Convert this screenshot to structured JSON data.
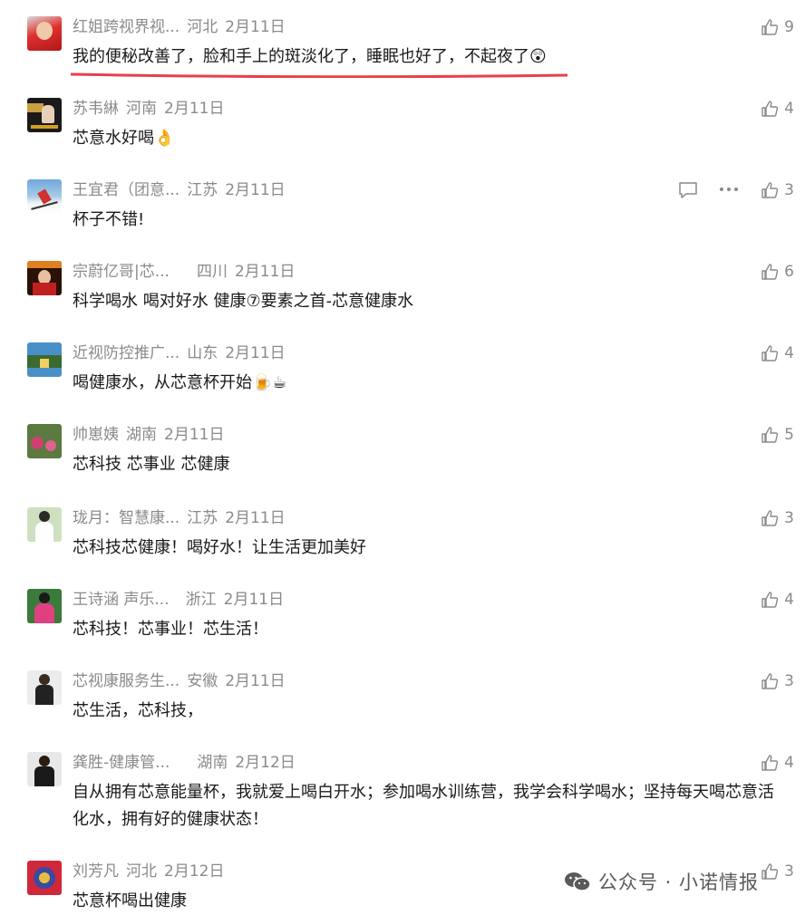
{
  "comments": [
    {
      "name": "红姐跨视界视...",
      "region": "河北",
      "date": "2月11日",
      "likes": "9",
      "text": "我的便秘改善了，脸和手上的斑淡化了，睡眠也好了，不起夜了😲"
    },
    {
      "name": "苏韦綝",
      "region": "河南",
      "date": "2月11日",
      "likes": "4",
      "text": "芯意水好喝👌"
    },
    {
      "name": "王宜君（团意...",
      "region": "江苏",
      "date": "2月11日",
      "likes": "3",
      "text": "杯子不错!"
    },
    {
      "name": "宗蔚亿哥|芯...",
      "region": "四川",
      "date": "2月11日",
      "likes": "6",
      "text": "科学喝水 喝对好水 健康⑦要素之首-芯意健康水"
    },
    {
      "name": "近视防控推广...",
      "region": "山东",
      "date": "2月11日",
      "likes": "4",
      "text": "喝健康水，从芯意杯开始🍺☕"
    },
    {
      "name": "帅崽姨",
      "region": "湖南",
      "date": "2月11日",
      "likes": "5",
      "text": "芯科技 芯事业 芯健康"
    },
    {
      "name": "珑月：智慧康...",
      "region": "江苏",
      "date": "2月11日",
      "likes": "3",
      "text": "芯科技芯健康！喝好水！让生活更加美好"
    },
    {
      "name": "王诗涵 声乐...",
      "region": "浙江",
      "date": "2月11日",
      "likes": "4",
      "text": "芯科技！芯事业！芯生活！"
    },
    {
      "name": "芯视康服务生...",
      "region": "安徽",
      "date": "2月11日",
      "likes": "3",
      "text": "芯生活，芯科技，"
    },
    {
      "name": "龚胜-健康管...",
      "region": "湖南",
      "date": "2月12日",
      "likes": "4",
      "text": "自从拥有芯意能量杯，我就爱上喝白开水；参加喝水训练营，我学会科学喝水；坚持每天喝芯意活化水，拥有好的健康状态！"
    },
    {
      "name": "刘芳凡",
      "region": "河北",
      "date": "2月12日",
      "likes": "3",
      "text": "芯意杯喝出健康"
    }
  ],
  "watermark": "公众号 · 小诺情报",
  "colors": {
    "underline": "#e8404a",
    "meta": "#8a8a8a",
    "text": "#1a1a1a"
  }
}
